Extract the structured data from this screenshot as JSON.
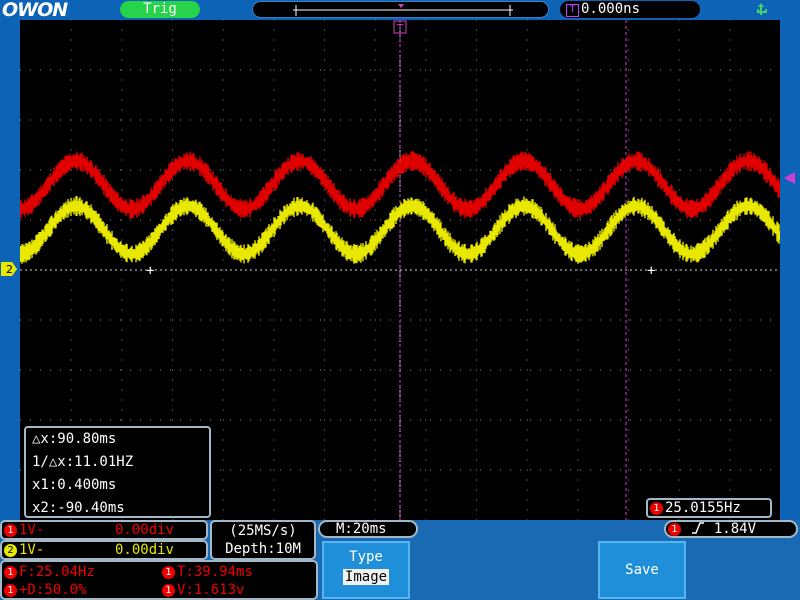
{
  "topbar": {
    "logo": "OWON",
    "trig_status": "Trig",
    "trigger_position": "0.000ns"
  },
  "markers": {
    "ch2_marker": "2",
    "trigger_marker": "T"
  },
  "cursor_readout": {
    "dx": "△x:90.80ms",
    "inv_dx": "1/△x:11.01HZ",
    "x1": "x1:0.400ms",
    "x2": "x2:-90.40ms"
  },
  "frequency": {
    "channel": "1",
    "value": "25.0155Hz"
  },
  "channels": [
    {
      "num": "1",
      "scale": "1V-",
      "offset": "0.00div",
      "color": "#e00000"
    },
    {
      "num": "2",
      "scale": "1V-",
      "offset": "0.00div",
      "color": "#e8e800"
    }
  ],
  "acquisition": {
    "sample_rate": "(25MS/s)",
    "depth": "Depth:10M"
  },
  "timebase": "M:20ms",
  "trigger": {
    "channel": "1",
    "level": "1.84V"
  },
  "measurements": {
    "channel": "1",
    "freq": "F:25.04Hz",
    "period": "T:39.94ms",
    "duty": "+D:50.0%",
    "vpp": "V:1.613v"
  },
  "menu": {
    "type_label": "Type",
    "type_value": "Image",
    "save_label": "Save"
  },
  "colors": {
    "ch1": "#e00000",
    "ch2": "#e8e800",
    "cursor": "#d040d0",
    "screen_bg": "#000000",
    "frame": "#0d63b5"
  }
}
